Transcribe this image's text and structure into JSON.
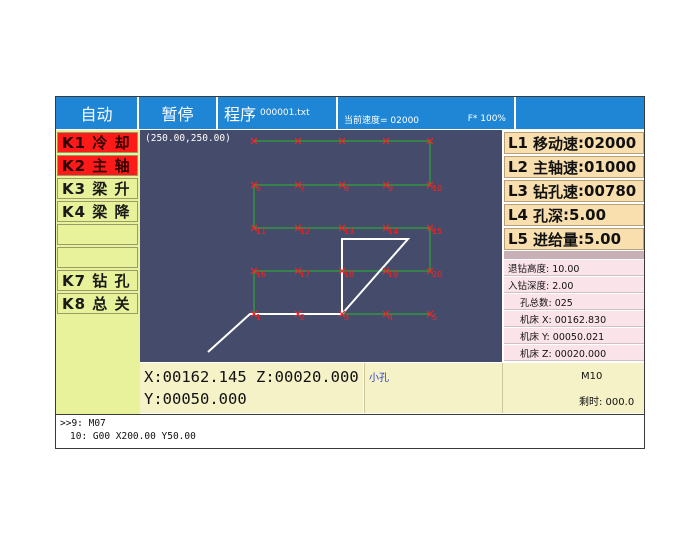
{
  "header": {
    "mode": "自动",
    "pause": "暂停",
    "program_label": "程序",
    "program_file": "000001.txt",
    "current_speed": "当前速度= 02000",
    "feed_override": "F* 100%"
  },
  "keys": [
    {
      "label": "K1 冷 却",
      "state": "active"
    },
    {
      "label": "K2 主 轴",
      "state": "active"
    },
    {
      "label": "K3 梁 升",
      "state": "normal"
    },
    {
      "label": "K4 梁 降",
      "state": "normal"
    },
    {
      "label": "",
      "state": "normal"
    },
    {
      "label": "",
      "state": "normal"
    },
    {
      "label": "K7 钻 孔",
      "state": "normal"
    },
    {
      "label": "K8 总 关",
      "state": "normal"
    }
  ],
  "plot": {
    "origin_label": "(250.00,250.00)",
    "hole_labels": [
      "6",
      "7",
      "8",
      "9",
      "10",
      "11",
      "12",
      "13",
      "14",
      "15",
      "16",
      "17",
      "18",
      "19",
      "20",
      "1",
      "2",
      "3",
      "4",
      "5"
    ]
  },
  "params": [
    {
      "key": "L1",
      "label": "移动速",
      "value": ":02000"
    },
    {
      "key": "L2",
      "label": "主轴速",
      "value": ":01000"
    },
    {
      "key": "L3",
      "label": "钻孔速",
      "value": ":00780"
    },
    {
      "key": "L4",
      "label": "孔深",
      "value": ":5.00"
    },
    {
      "key": "L5",
      "label": "进给量",
      "value": ":5.00"
    }
  ],
  "info": {
    "retract_height": "退钻高度: 10.00",
    "entry_depth": "入钻深度: 2.00",
    "hole_count": "孔总数: 025",
    "machine_x": "机床 X: 00162.830",
    "machine_y": "机床 Y: 00050.021",
    "machine_z": "机床 Z: 00020.000"
  },
  "coords": {
    "x": "X:00162.145",
    "z": "Z:00020.000",
    "y": "Y:00050.000"
  },
  "message": "小孔",
  "status": {
    "mcode": "M10",
    "remaining": "剩时: 000.0"
  },
  "gcode": {
    "line1": ">>9: M07",
    "line2": "10: G00 X200.00 Y50.00"
  },
  "colors": {
    "header_blue": "#1f86d6",
    "key_red": "#ff1a1a",
    "key_yellow": "#e8f29a",
    "plot_bg": "#454c6b",
    "param_orange": "#f9dfae",
    "info_pink": "#fbe3ea",
    "path_green": "#28b828",
    "hole_red": "#ff2020"
  }
}
